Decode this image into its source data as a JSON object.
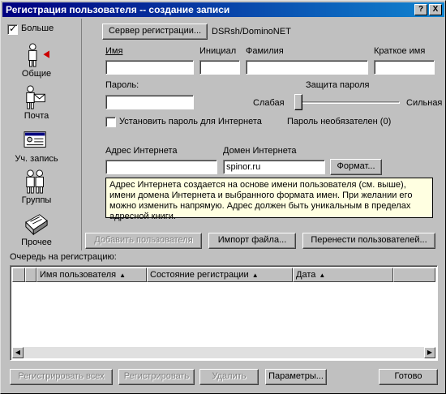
{
  "window": {
    "title": "Регистрация пользователя -- создание записи",
    "help_btn": "?",
    "close_btn": "X"
  },
  "sidebar": {
    "more_label": "Больше",
    "more_checked": true,
    "items": [
      {
        "label": "Общие",
        "icon": "person-icon",
        "selected": true
      },
      {
        "label": "Почта",
        "icon": "mail-icon"
      },
      {
        "label": "Уч. запись",
        "icon": "id-card-icon"
      },
      {
        "label": "Группы",
        "icon": "group-icon"
      },
      {
        "label": "Прочее",
        "icon": "misc-icon"
      }
    ]
  },
  "server": {
    "button_label": "Сервер регистрации...",
    "value": "DSRsh/DominoNET"
  },
  "name": {
    "first_label": "Имя",
    "initial_label": "Инициал",
    "last_label": "Фамилия",
    "short_label": "Краткое имя",
    "first_value": "",
    "initial_value": "",
    "last_value": "",
    "short_value": ""
  },
  "password": {
    "label": "Пароль:",
    "value": "",
    "strength_title": "Защита пароля",
    "weak_label": "Слабая",
    "strong_label": "Сильная",
    "strength_level": 0,
    "internet_checkbox_label": "Установить пароль для Интернета",
    "internet_checked": false,
    "optional_status": "Пароль необязателен (0)"
  },
  "internet": {
    "address_label": "Адрес Интернета",
    "address_value": "",
    "domain_label": "Домен Интернета",
    "domain_value": "spinor.ru",
    "format_button": "Формат...",
    "info_text": "Адрес Интернета создается на основе имени пользователя (см. выше), имени домена Интернета и выбранного формата имен.  При желании его можно изменить напрямую.  Адрес должен быть уникальным в пределах адресной книги."
  },
  "actions": {
    "add_user": "Добавить пользователя",
    "import_file": "Импорт файла...",
    "move_users": "Перенести пользователей..."
  },
  "queue": {
    "label": "Очередь на регистрацию:",
    "columns": [
      "Имя пользователя",
      "Состояние регистрации",
      "Дата"
    ],
    "rows": []
  },
  "footer": {
    "register_all": "Регистрировать всех",
    "register": "Регистрировать",
    "delete": "Удалить",
    "params": "Параметры...",
    "done": "Готово"
  },
  "colors": {
    "title_start": "#000080",
    "title_end": "#1084d0",
    "selected_arrow": "#cc0000",
    "info_bg": "#ffffe1"
  }
}
